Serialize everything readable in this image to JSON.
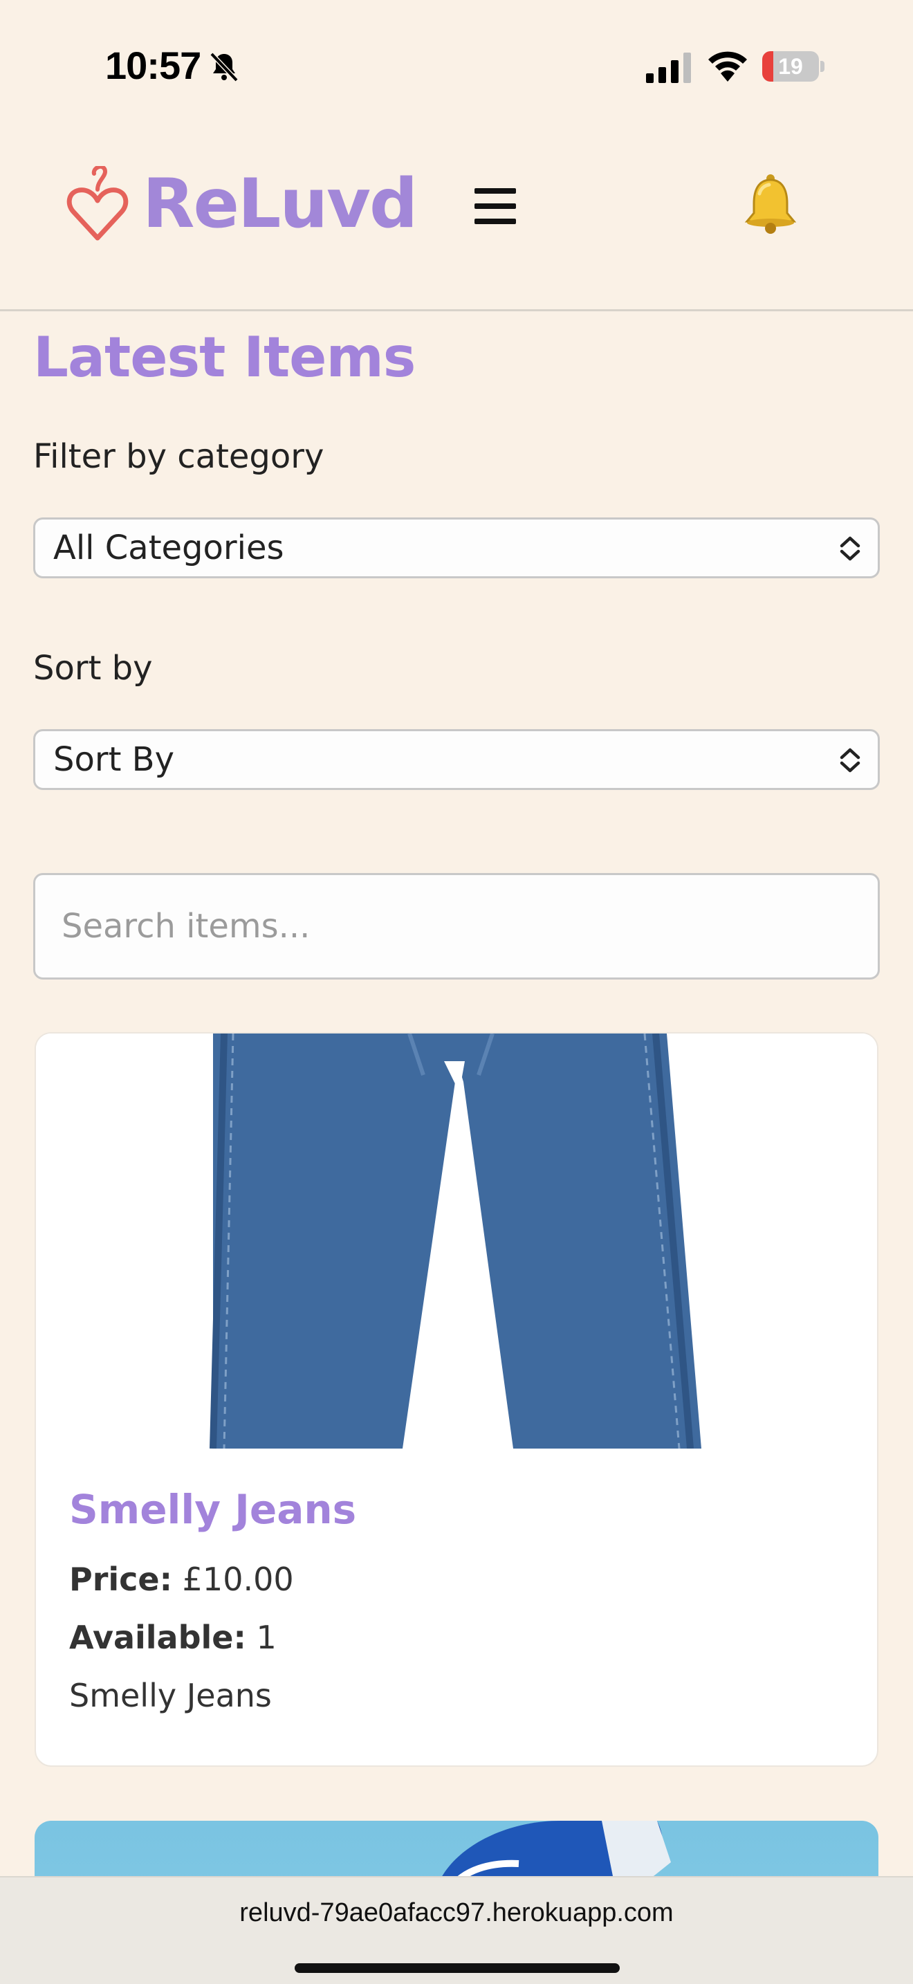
{
  "status_bar": {
    "time": "10:57",
    "battery_level": 19,
    "battery_text": "19",
    "icons": [
      "bell-slash-icon",
      "cellular-signal-icon",
      "wifi-icon",
      "battery-charging-icon"
    ]
  },
  "header": {
    "logo_text": "ReLuvd",
    "logo_icon": "heart-hanger-icon",
    "menu_icon": "hamburger-menu-icon",
    "notification_icon": "bell-icon"
  },
  "main": {
    "title": "Latest Items",
    "filter": {
      "label": "Filter by category",
      "selected": "All Categories"
    },
    "sort": {
      "label": "Sort by",
      "selected": "Sort By"
    },
    "search": {
      "placeholder": "Search items..."
    }
  },
  "items": [
    {
      "title": "Smelly Jeans",
      "price_label": "Price:",
      "price": "£10.00",
      "available_label": "Available:",
      "available": "1",
      "description": "Smelly Jeans"
    }
  ],
  "browser": {
    "url": "reluvd-79ae0afacc97.herokuapp.com"
  },
  "colors": {
    "background": "#faf1e6",
    "brand_purple": "#a283db",
    "logo_heart": "#e5625b",
    "battery_low": "#e8413c"
  }
}
